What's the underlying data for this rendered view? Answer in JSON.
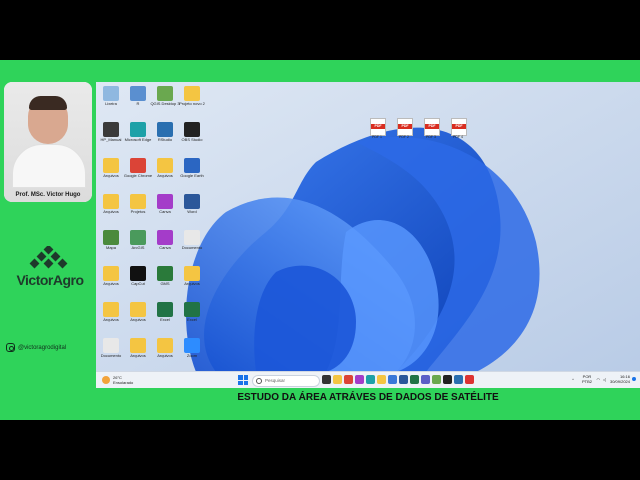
{
  "presenter": {
    "name": "Prof. MSc. Victor Hugo"
  },
  "brand": {
    "logo_text": "VictorAgro",
    "instagram": "@victoragrodigital",
    "green": "#2fd35a",
    "dark": "#1e3a2b"
  },
  "caption": "ESTUDO DA ÁREA ATRÁVES DE DADOS DE SATÉLITE",
  "desktop": {
    "icons": [
      {
        "label": "Lixeira",
        "icon": "recycle-bin-icon",
        "color": "#8fb8e0"
      },
      {
        "label": "R",
        "icon": "r-app-icon",
        "color": "#5a8fd0"
      },
      {
        "label": "QGIS Desktop 3",
        "icon": "qgis-icon",
        "color": "#6aa84f"
      },
      {
        "label": "Projeto novo 2",
        "icon": "folder-icon",
        "color": "#f4c542"
      },
      {
        "label": "HP_Manual",
        "icon": "hp-icon",
        "color": "#3a3a3a"
      },
      {
        "label": "Microsoft Edge",
        "icon": "edge-icon",
        "color": "#1da1a8"
      },
      {
        "label": "RStudio",
        "icon": "rstudio-icon",
        "color": "#2a6fb0"
      },
      {
        "label": "OBS Studio",
        "icon": "obs-icon",
        "color": "#222"
      },
      {
        "label": "Arquivos",
        "icon": "folder-icon",
        "color": "#f4c542"
      },
      {
        "label": "Google Chrome",
        "icon": "chrome-icon",
        "color": "#db4437"
      },
      {
        "label": "Arquivos",
        "icon": "folder-icon",
        "color": "#f4c542"
      },
      {
        "label": "Google Earth",
        "icon": "earth-icon",
        "color": "#2b66c2"
      },
      {
        "label": "Arquivos",
        "icon": "folder-icon",
        "color": "#f4c542"
      },
      {
        "label": "Projetos",
        "icon": "folder-icon",
        "color": "#f4c542"
      },
      {
        "label": "Canva",
        "icon": "canva-icon",
        "color": "#a43cc9"
      },
      {
        "label": "Word",
        "icon": "word-icon",
        "color": "#2b579a"
      },
      {
        "label": "Mapa",
        "icon": "map-icon",
        "color": "#4a8a3c"
      },
      {
        "label": "ArcGIS",
        "icon": "arcgis-icon",
        "color": "#4a9a5c"
      },
      {
        "label": "Canva",
        "icon": "canva-icon",
        "color": "#a43cc9"
      },
      {
        "label": "Documento",
        "icon": "document-icon",
        "color": "#e8e8e8"
      },
      {
        "label": "Arquivos",
        "icon": "folder-icon",
        "color": "#f4c542"
      },
      {
        "label": "CapCut",
        "icon": "capcut-icon",
        "color": "#111"
      },
      {
        "label": "GMS",
        "icon": "gms-icon",
        "color": "#2a7a3a"
      },
      {
        "label": "Arquivos",
        "icon": "folder-icon",
        "color": "#f4c542"
      },
      {
        "label": "Arquivos",
        "icon": "folder-icon",
        "color": "#f4c542"
      },
      {
        "label": "Arquivos",
        "icon": "folder-icon",
        "color": "#f4c542"
      },
      {
        "label": "Excel",
        "icon": "excel-icon",
        "color": "#217346"
      },
      {
        "label": "Excel",
        "icon": "excel-icon",
        "color": "#217346"
      },
      {
        "label": "Documento",
        "icon": "document-icon",
        "color": "#e8e8e8"
      },
      {
        "label": "Arquivos",
        "icon": "folder-icon",
        "color": "#f4c542"
      },
      {
        "label": "Arquivos",
        "icon": "folder-icon",
        "color": "#f4c542"
      },
      {
        "label": "Zoom",
        "icon": "zoom-icon",
        "color": "#2d8cff"
      }
    ],
    "pdf_files": [
      {
        "label": "PDF 1",
        "icon": "pdf-icon"
      },
      {
        "label": "PDF 2",
        "icon": "pdf-icon"
      },
      {
        "label": "PDF 3",
        "icon": "pdf-icon"
      },
      {
        "label": "PDF 4",
        "icon": "pdf-icon"
      }
    ]
  },
  "taskbar": {
    "weather_temp": "26°C",
    "weather_desc": "Ensolarado",
    "search_placeholder": "Pesquisar",
    "lang": "POR",
    "lang2": "PTB2",
    "time": "16:16",
    "date": "30/09/2024",
    "apps": [
      {
        "icon": "task-view-icon",
        "color": "#333"
      },
      {
        "icon": "file-explorer-icon",
        "color": "#f4c542"
      },
      {
        "icon": "chrome-icon",
        "color": "#db4437"
      },
      {
        "icon": "canva-icon",
        "color": "#a43cc9"
      },
      {
        "icon": "edge-icon",
        "color": "#1da1a8"
      },
      {
        "icon": "folder-icon",
        "color": "#f4c542"
      },
      {
        "icon": "store-icon",
        "color": "#3a78d8"
      },
      {
        "icon": "word-icon",
        "color": "#2b579a"
      },
      {
        "icon": "excel-icon",
        "color": "#217346"
      },
      {
        "icon": "teams-icon",
        "color": "#5b5fc7"
      },
      {
        "icon": "qgis-icon",
        "color": "#6aa84f"
      },
      {
        "icon": "obs-icon",
        "color": "#222"
      },
      {
        "icon": "rstudio-icon",
        "color": "#2a6fb0"
      },
      {
        "icon": "record-icon",
        "color": "#d33"
      }
    ]
  }
}
